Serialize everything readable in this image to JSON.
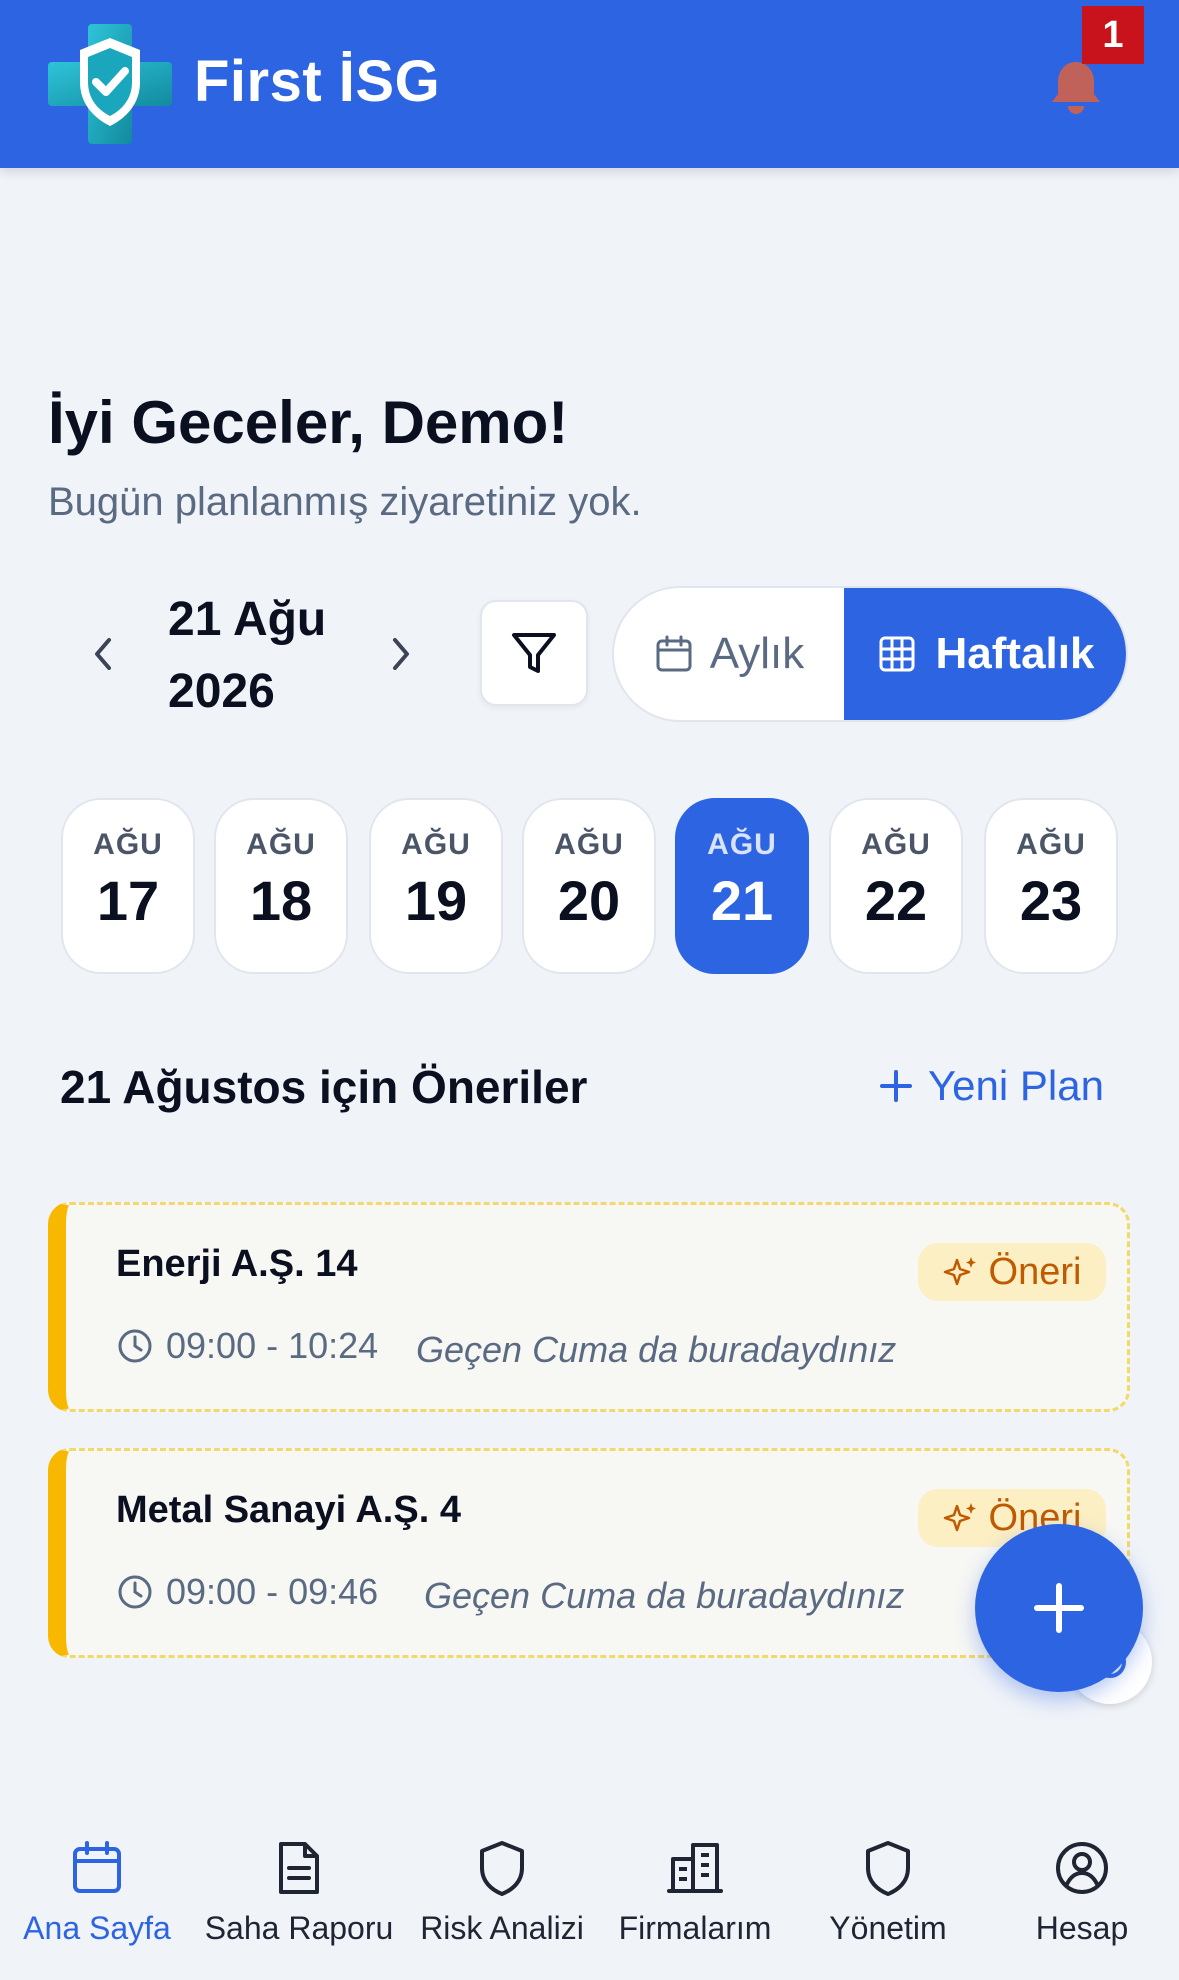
{
  "header": {
    "title": "First İSG",
    "notification_count": "1",
    "logo_icon": "shield-check-cross-icon",
    "bell_icon": "bell-icon",
    "colors": {
      "primary": "#2d64e2",
      "badge": "#c8131d"
    }
  },
  "greeting": {
    "title": "İyi Geceler, Demo!",
    "subtitle": "Bugün planlanmış ziyaretiniz yok."
  },
  "date_nav": {
    "date_line1": "21 Ağu",
    "date_line2": "2026"
  },
  "view_toggle": {
    "monthly_label": "Aylık",
    "weekly_label": "Haftalık",
    "selected": "weekly"
  },
  "days": [
    {
      "month": "AĞU",
      "day": "17",
      "active": false
    },
    {
      "month": "AĞU",
      "day": "18",
      "active": false
    },
    {
      "month": "AĞU",
      "day": "19",
      "active": false
    },
    {
      "month": "AĞU",
      "day": "20",
      "active": false
    },
    {
      "month": "AĞU",
      "day": "21",
      "active": true
    },
    {
      "month": "AĞU",
      "day": "22",
      "active": false
    },
    {
      "month": "AĞU",
      "day": "23",
      "active": false
    }
  ],
  "suggestions": {
    "title": "21 Ağustos için Öneriler",
    "new_plan_label": "Yeni Plan",
    "items": [
      {
        "name": "Enerji A.Ş. 14",
        "badge": "Öneri",
        "time": "09:00 - 10:24",
        "note": "Geçen Cuma da buradaydınız"
      },
      {
        "name": "Metal Sanayi A.Ş. 4",
        "badge": "Öneri",
        "time": "09:00 - 09:46",
        "note": "Geçen Cuma da buradaydınız"
      }
    ]
  },
  "bottom_nav": [
    {
      "label": "Ana Sayfa",
      "icon": "calendar-icon",
      "active": true
    },
    {
      "label": "Saha Raporu",
      "icon": "document-icon",
      "active": false
    },
    {
      "label": "Risk Analizi",
      "icon": "shield-icon",
      "active": false
    },
    {
      "label": "Firmalarım",
      "icon": "buildings-icon",
      "active": false
    },
    {
      "label": "Yönetim",
      "icon": "shield-icon",
      "active": false
    },
    {
      "label": "Hesap",
      "icon": "user-circle-icon",
      "active": false
    }
  ]
}
